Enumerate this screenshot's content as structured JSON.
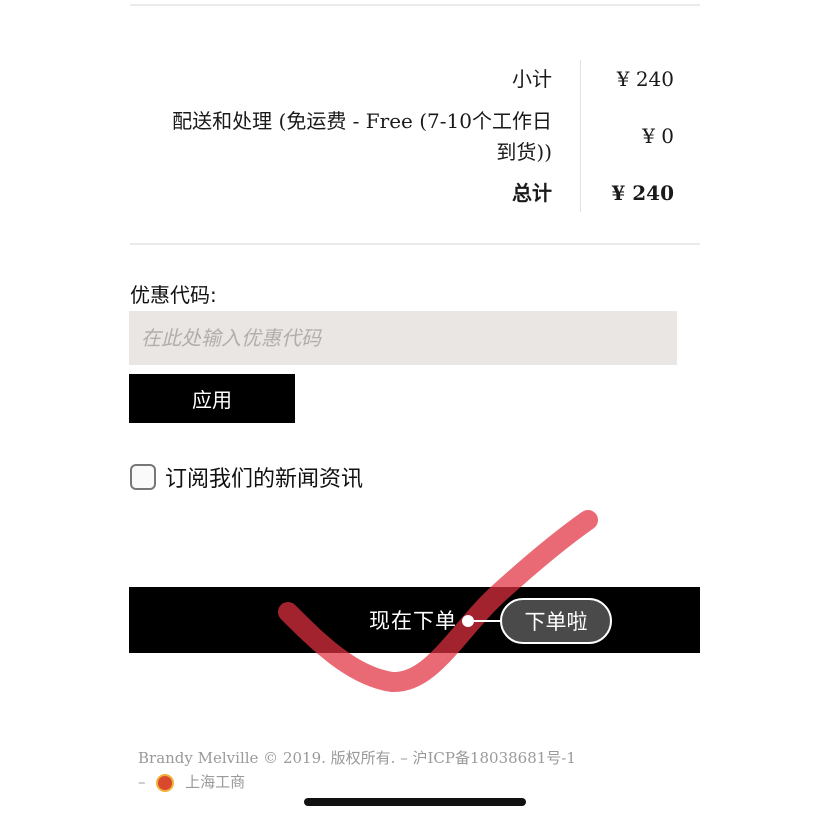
{
  "summary": {
    "subtotal_label": "小计",
    "subtotal_value": "¥ 240",
    "shipping_label_line1": "配送和处理 (免运费 - Free (7-10个工作日",
    "shipping_label_line2": "到货))",
    "shipping_value": "¥ 0",
    "total_label": "总计",
    "total_value": "¥ 240"
  },
  "promo": {
    "title": "优惠代码:",
    "placeholder": "在此处输入优惠代码",
    "value": "",
    "apply_label": "应用"
  },
  "newsletter": {
    "label": "订阅我们的新闻资讯",
    "checked": false
  },
  "order": {
    "place_order_label": "现在下单"
  },
  "annotation": {
    "callout_text": "下单啦",
    "stroke_color": "#e0303f"
  },
  "footer": {
    "copyright": "Brandy Melville © 2019. 版权所有. – 沪ICP备18038681号-1",
    "dash": "–",
    "badge_label": "上海工商",
    "badge_icon": "police-badge-icon"
  },
  "colors": {
    "button_bg": "#000000",
    "input_bg": "#e9e6e3",
    "placeholder": "#b2aeaa",
    "footer_text": "#9a9a9a"
  }
}
